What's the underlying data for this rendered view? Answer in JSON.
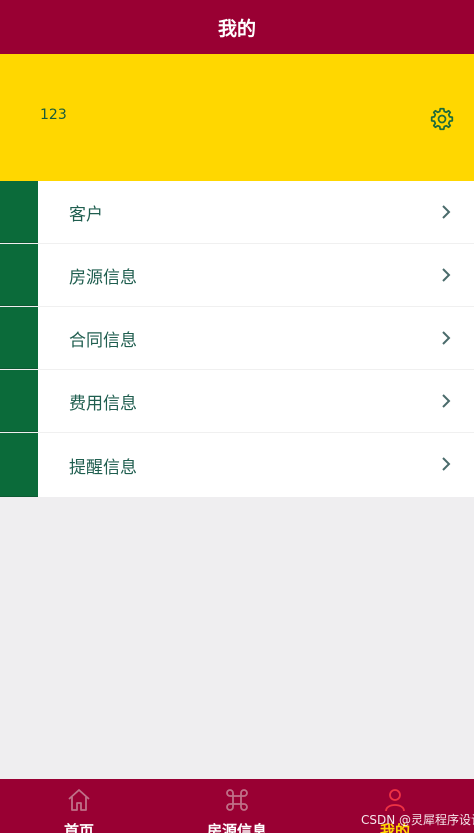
{
  "header": {
    "title": "我的"
  },
  "profile": {
    "user_id": "123",
    "settings_icon": "gear-icon"
  },
  "menu": {
    "items": [
      {
        "label": "客户",
        "icon": "chevron-right-icon"
      },
      {
        "label": "房源信息",
        "icon": "chevron-right-icon"
      },
      {
        "label": "合同信息",
        "icon": "chevron-right-icon"
      },
      {
        "label": "费用信息",
        "icon": "chevron-right-icon"
      },
      {
        "label": "提醒信息",
        "icon": "chevron-right-icon"
      }
    ]
  },
  "tabbar": {
    "tabs": [
      {
        "label": "首页",
        "icon": "home-icon",
        "active": false
      },
      {
        "label": "房源信息",
        "icon": "command-icon",
        "active": false
      },
      {
        "label": "我的",
        "icon": "person-icon",
        "active": true
      }
    ]
  },
  "watermark": "CSDN @灵犀程序设计",
  "colors": {
    "primary": "#990033",
    "accent": "#ffd700",
    "sidebar_green": "#0b6b3a",
    "text_green": "#1f5e4f",
    "background": "#efeef0"
  }
}
